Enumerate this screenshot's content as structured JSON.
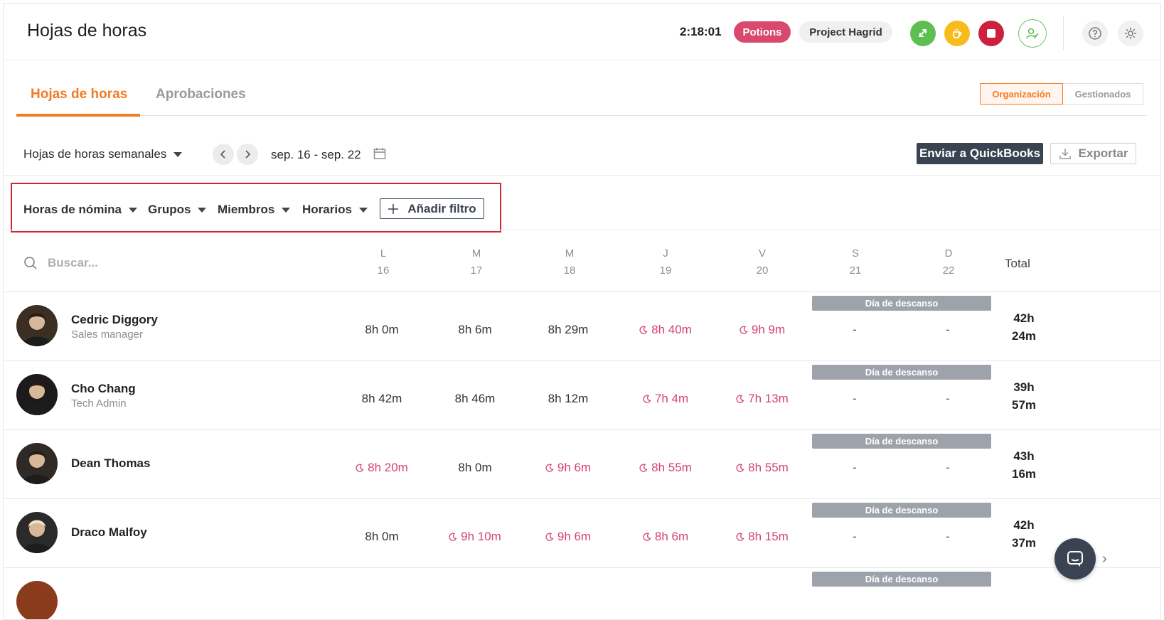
{
  "header": {
    "title": "Hojas de horas",
    "timer": "2:18:01",
    "activity": "Potions",
    "project": "Project Hagrid"
  },
  "tabs": [
    {
      "label": "Hojas de horas",
      "active": true
    },
    {
      "label": "Aprobaciones",
      "active": false
    }
  ],
  "scope": {
    "organization": "Organización",
    "managed": "Gestionados"
  },
  "toolbar": {
    "period": "Hojas de horas semanales",
    "date_range": "sep. 16 - sep. 22",
    "quickbooks": "Enviar a QuickBooks",
    "export": "Exportar"
  },
  "filters": {
    "items": [
      "Horas de nómina",
      "Grupos",
      "Miembros",
      "Horarios"
    ],
    "add": "Añadir filtro"
  },
  "grid": {
    "search_placeholder": "Buscar...",
    "days": [
      {
        "letter": "L",
        "num": "16"
      },
      {
        "letter": "M",
        "num": "17"
      },
      {
        "letter": "M",
        "num": "18"
      },
      {
        "letter": "J",
        "num": "19"
      },
      {
        "letter": "V",
        "num": "20"
      },
      {
        "letter": "S",
        "num": "21"
      },
      {
        "letter": "D",
        "num": "22"
      }
    ],
    "total_label": "Total",
    "off_label": "Día de descanso"
  },
  "rows": [
    {
      "name": "Cedric Diggory",
      "role": "Sales manager",
      "cells": [
        "8h 0m",
        "8h 6m",
        "8h 29m",
        "8h 40m",
        "9h 9m",
        "-",
        "-"
      ],
      "late": [
        false,
        false,
        false,
        true,
        true,
        false,
        false
      ],
      "total1": "42h",
      "total2": "24m"
    },
    {
      "name": "Cho Chang",
      "role": "Tech Admin",
      "cells": [
        "8h 42m",
        "8h 46m",
        "8h 12m",
        "7h 4m",
        "7h 13m",
        "-",
        "-"
      ],
      "late": [
        false,
        false,
        false,
        true,
        true,
        false,
        false
      ],
      "total1": "39h",
      "total2": "57m"
    },
    {
      "name": "Dean Thomas",
      "role": "",
      "cells": [
        "8h 20m",
        "8h 0m",
        "9h 6m",
        "8h 55m",
        "8h 55m",
        "-",
        "-"
      ],
      "late": [
        true,
        false,
        true,
        true,
        true,
        false,
        false
      ],
      "total1": "43h",
      "total2": "16m"
    },
    {
      "name": "Draco Malfoy",
      "role": "",
      "cells": [
        "8h 0m",
        "9h 10m",
        "9h 6m",
        "8h 6m",
        "8h 15m",
        "-",
        "-"
      ],
      "late": [
        false,
        true,
        true,
        true,
        true,
        false,
        false
      ],
      "total1": "42h",
      "total2": "37m"
    }
  ],
  "colors": {
    "accent": "#f27b26",
    "late": "#d4456d",
    "dark": "#3a4352",
    "off": "#9ea3ab"
  }
}
